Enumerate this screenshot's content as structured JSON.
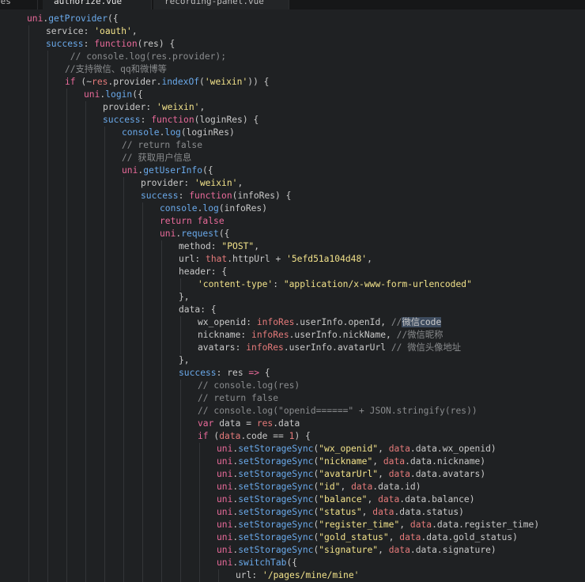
{
  "tabs": [
    {
      "label": "res"
    },
    {
      "label": "authorize.vue"
    },
    {
      "label": "recording-panel.vue"
    }
  ],
  "lines": [
    {
      "indent": 0,
      "tokens": [
        [
          "k",
          "uni"
        ],
        [
          "p",
          "."
        ],
        [
          "f",
          "getProvider"
        ],
        [
          "p",
          "({"
        ]
      ]
    },
    {
      "indent": 1,
      "tokens": [
        [
          "p",
          "service: "
        ],
        [
          "s",
          "'oauth'"
        ],
        [
          "p",
          ","
        ]
      ]
    },
    {
      "indent": 1,
      "tokens": [
        [
          "f",
          "success"
        ],
        [
          "p",
          ": "
        ],
        [
          "k",
          "function"
        ],
        [
          "p",
          "(res) {"
        ]
      ]
    },
    {
      "indent": 2,
      "tokens": [
        [
          "c",
          " // console.log(res.provider);"
        ]
      ]
    },
    {
      "indent": 2,
      "tokens": [
        [
          "c",
          "//支持微信、qq和微博等"
        ]
      ]
    },
    {
      "indent": 2,
      "tokens": [
        [
          "k",
          "if"
        ],
        [
          "p",
          " (~"
        ],
        [
          "r",
          "res"
        ],
        [
          "p",
          ".provider."
        ],
        [
          "f",
          "indexOf"
        ],
        [
          "p",
          "("
        ],
        [
          "s",
          "'weixin'"
        ],
        [
          "p",
          ")) {"
        ]
      ]
    },
    {
      "indent": 3,
      "tokens": [
        [
          "k",
          "uni"
        ],
        [
          "p",
          "."
        ],
        [
          "f",
          "login"
        ],
        [
          "p",
          "({"
        ]
      ]
    },
    {
      "indent": 4,
      "tokens": [
        [
          "p",
          "provider: "
        ],
        [
          "s",
          "'weixin'"
        ],
        [
          "p",
          ","
        ]
      ]
    },
    {
      "indent": 4,
      "tokens": [
        [
          "f",
          "success"
        ],
        [
          "p",
          ": "
        ],
        [
          "k",
          "function"
        ],
        [
          "p",
          "(loginRes) {"
        ]
      ]
    },
    {
      "indent": 5,
      "tokens": [
        [
          "f",
          "console"
        ],
        [
          "p",
          "."
        ],
        [
          "f",
          "log"
        ],
        [
          "p",
          "(loginRes)"
        ]
      ]
    },
    {
      "indent": 5,
      "tokens": [
        [
          "c",
          "// return false"
        ]
      ]
    },
    {
      "indent": 5,
      "tokens": [
        [
          "c",
          "// 获取用户信息"
        ]
      ]
    },
    {
      "indent": 5,
      "tokens": [
        [
          "k",
          "uni"
        ],
        [
          "p",
          "."
        ],
        [
          "f",
          "getUserInfo"
        ],
        [
          "p",
          "({"
        ]
      ]
    },
    {
      "indent": 6,
      "tokens": [
        [
          "p",
          "provider: "
        ],
        [
          "s",
          "'weixin'"
        ],
        [
          "p",
          ","
        ]
      ]
    },
    {
      "indent": 6,
      "tokens": [
        [
          "f",
          "success"
        ],
        [
          "p",
          ": "
        ],
        [
          "k",
          "function"
        ],
        [
          "p",
          "(infoRes) {"
        ]
      ]
    },
    {
      "indent": 7,
      "tokens": [
        [
          "f",
          "console"
        ],
        [
          "p",
          "."
        ],
        [
          "f",
          "log"
        ],
        [
          "p",
          "(infoRes)"
        ]
      ]
    },
    {
      "indent": 7,
      "tokens": [
        [
          "k",
          "return"
        ],
        [
          "p",
          " "
        ],
        [
          "k",
          "false"
        ]
      ]
    },
    {
      "indent": 7,
      "tokens": [
        [
          "k",
          "uni"
        ],
        [
          "p",
          "."
        ],
        [
          "f",
          "request"
        ],
        [
          "p",
          "({"
        ]
      ]
    },
    {
      "indent": 8,
      "tokens": [
        [
          "p",
          "method: "
        ],
        [
          "s",
          "\"POST\""
        ],
        [
          "p",
          ","
        ]
      ]
    },
    {
      "indent": 8,
      "tokens": [
        [
          "p",
          "url: "
        ],
        [
          "r",
          "that"
        ],
        [
          "p",
          ".httpUrl + "
        ],
        [
          "s",
          "'5efd51a104d48'"
        ],
        [
          "p",
          ","
        ]
      ]
    },
    {
      "indent": 8,
      "tokens": [
        [
          "p",
          "header: {"
        ]
      ]
    },
    {
      "indent": 9,
      "tokens": [
        [
          "s",
          "'content-type'"
        ],
        [
          "p",
          ": "
        ],
        [
          "s",
          "\"application/x-www-form-urlencoded\""
        ]
      ]
    },
    {
      "indent": 8,
      "tokens": [
        [
          "p",
          "},"
        ]
      ]
    },
    {
      "indent": 8,
      "tokens": [
        [
          "p",
          "data: {"
        ]
      ]
    },
    {
      "indent": 9,
      "tokens": [
        [
          "p",
          "wx_openid: "
        ],
        [
          "r",
          "infoRes"
        ],
        [
          "p",
          ".userInfo.openId, "
        ],
        [
          "c",
          "//"
        ],
        [
          "hl",
          "微信code"
        ]
      ]
    },
    {
      "indent": 9,
      "tokens": [
        [
          "p",
          "nickname: "
        ],
        [
          "r",
          "infoRes"
        ],
        [
          "p",
          ".userInfo.nickName, "
        ],
        [
          "c",
          "//微信昵称"
        ]
      ]
    },
    {
      "indent": 9,
      "tokens": [
        [
          "p",
          "avatars: "
        ],
        [
          "r",
          "infoRes"
        ],
        [
          "p",
          ".userInfo.avatarUrl "
        ],
        [
          "c",
          "// 微信头像地址"
        ]
      ]
    },
    {
      "indent": 8,
      "tokens": [
        [
          "p",
          "},"
        ]
      ]
    },
    {
      "indent": 8,
      "tokens": [
        [
          "f",
          "success"
        ],
        [
          "p",
          ": res "
        ],
        [
          "k",
          "=>"
        ],
        [
          "p",
          " {"
        ]
      ]
    },
    {
      "indent": 9,
      "tokens": [
        [
          "c",
          "// console.log(res)"
        ]
      ]
    },
    {
      "indent": 9,
      "tokens": [
        [
          "c",
          "// return false"
        ]
      ]
    },
    {
      "indent": 9,
      "tokens": [
        [
          "c",
          "// console.log(\"openid======\" + JSON.stringify(res))"
        ]
      ]
    },
    {
      "indent": 9,
      "tokens": [
        [
          "k",
          "var"
        ],
        [
          "p",
          " data = "
        ],
        [
          "r",
          "res"
        ],
        [
          "p",
          ".data"
        ]
      ]
    },
    {
      "indent": 9,
      "tokens": [
        [
          "k",
          "if"
        ],
        [
          "p",
          " ("
        ],
        [
          "r",
          "data"
        ],
        [
          "p",
          ".code == "
        ],
        [
          "r",
          "1"
        ],
        [
          "p",
          ") {"
        ]
      ]
    },
    {
      "indent": 10,
      "tokens": [
        [
          "k",
          "uni"
        ],
        [
          "p",
          "."
        ],
        [
          "f",
          "setStorageSync"
        ],
        [
          "p",
          "("
        ],
        [
          "s",
          "\"wx_openid\""
        ],
        [
          "p",
          ", "
        ],
        [
          "r",
          "data"
        ],
        [
          "p",
          ".data.wx_openid)"
        ]
      ]
    },
    {
      "indent": 10,
      "tokens": [
        [
          "k",
          "uni"
        ],
        [
          "p",
          "."
        ],
        [
          "f",
          "setStorageSync"
        ],
        [
          "p",
          "("
        ],
        [
          "s",
          "\"nickname\""
        ],
        [
          "p",
          ", "
        ],
        [
          "r",
          "data"
        ],
        [
          "p",
          ".data.nickname)"
        ]
      ]
    },
    {
      "indent": 10,
      "tokens": [
        [
          "k",
          "uni"
        ],
        [
          "p",
          "."
        ],
        [
          "f",
          "setStorageSync"
        ],
        [
          "p",
          "("
        ],
        [
          "s",
          "\"avatarUrl\""
        ],
        [
          "p",
          ", "
        ],
        [
          "r",
          "data"
        ],
        [
          "p",
          ".data.avatars)"
        ]
      ]
    },
    {
      "indent": 10,
      "tokens": [
        [
          "k",
          "uni"
        ],
        [
          "p",
          "."
        ],
        [
          "f",
          "setStorageSync"
        ],
        [
          "p",
          "("
        ],
        [
          "s",
          "\"id\""
        ],
        [
          "p",
          ", "
        ],
        [
          "r",
          "data"
        ],
        [
          "p",
          ".data.id)"
        ]
      ]
    },
    {
      "indent": 10,
      "tokens": [
        [
          "k",
          "uni"
        ],
        [
          "p",
          "."
        ],
        [
          "f",
          "setStorageSync"
        ],
        [
          "p",
          "("
        ],
        [
          "s",
          "\"balance\""
        ],
        [
          "p",
          ", "
        ],
        [
          "r",
          "data"
        ],
        [
          "p",
          ".data.balance)"
        ]
      ]
    },
    {
      "indent": 10,
      "tokens": [
        [
          "k",
          "uni"
        ],
        [
          "p",
          "."
        ],
        [
          "f",
          "setStorageSync"
        ],
        [
          "p",
          "("
        ],
        [
          "s",
          "\"status\""
        ],
        [
          "p",
          ", "
        ],
        [
          "r",
          "data"
        ],
        [
          "p",
          ".data.status)"
        ]
      ]
    },
    {
      "indent": 10,
      "tokens": [
        [
          "k",
          "uni"
        ],
        [
          "p",
          "."
        ],
        [
          "f",
          "setStorageSync"
        ],
        [
          "p",
          "("
        ],
        [
          "s",
          "\"register_time\""
        ],
        [
          "p",
          ", "
        ],
        [
          "r",
          "data"
        ],
        [
          "p",
          ".data.register_time)"
        ]
      ]
    },
    {
      "indent": 10,
      "tokens": [
        [
          "k",
          "uni"
        ],
        [
          "p",
          "."
        ],
        [
          "f",
          "setStorageSync"
        ],
        [
          "p",
          "("
        ],
        [
          "s",
          "\"gold_status\""
        ],
        [
          "p",
          ", "
        ],
        [
          "r",
          "data"
        ],
        [
          "p",
          ".data.gold_status)"
        ]
      ]
    },
    {
      "indent": 10,
      "tokens": [
        [
          "k",
          "uni"
        ],
        [
          "p",
          "."
        ],
        [
          "f",
          "setStorageSync"
        ],
        [
          "p",
          "("
        ],
        [
          "s",
          "\"signature\""
        ],
        [
          "p",
          ", "
        ],
        [
          "r",
          "data"
        ],
        [
          "p",
          ".data.signature)"
        ]
      ]
    },
    {
      "indent": 10,
      "tokens": [
        [
          "k",
          "uni"
        ],
        [
          "p",
          "."
        ],
        [
          "f",
          "switchTab"
        ],
        [
          "p",
          "({"
        ]
      ]
    },
    {
      "indent": 11,
      "tokens": [
        [
          "p",
          "url: "
        ],
        [
          "s",
          "'/pages/mine/mine'"
        ]
      ]
    }
  ]
}
